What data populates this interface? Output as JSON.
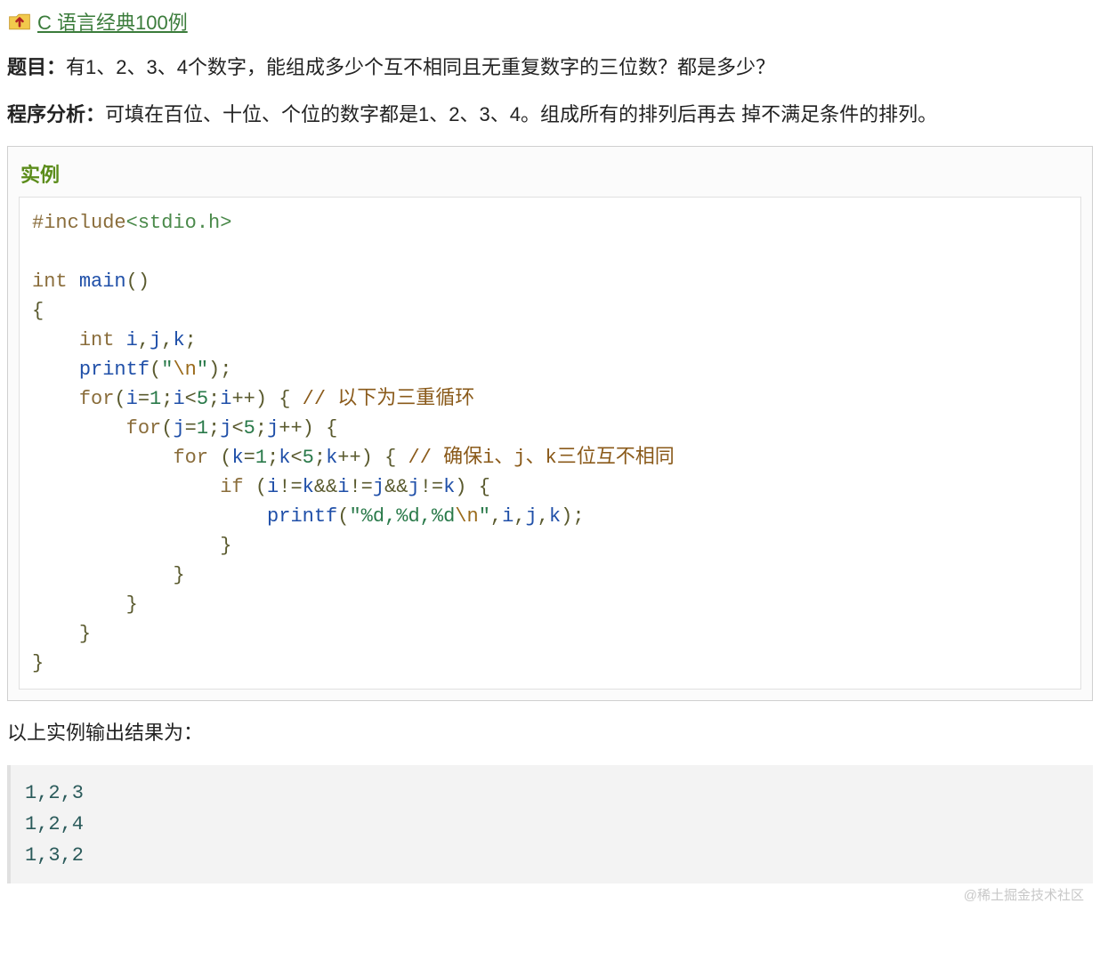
{
  "nav": {
    "link_text": "C 语言经典100例"
  },
  "problem": {
    "label": "题目：",
    "text": "有1、2、3、4个数字，能组成多少个互不相同且无重复数字的三位数？都是多少？"
  },
  "analysis": {
    "label": "程序分析：",
    "text": "可填在百位、十位、个位的数字都是1、2、3、4。组成所有的排列后再去 掉不满足条件的排列。"
  },
  "example": {
    "title": "实例"
  },
  "code": {
    "t_include": "#include",
    "t_header": "<stdio.h>",
    "t_int": "int",
    "t_main": "main",
    "t_for": "for",
    "t_if": "if",
    "t_printf": "printf",
    "v_i": "i",
    "v_j": "j",
    "v_k": "k",
    "n1": "1",
    "n5": "5",
    "s_nl_open": "\"",
    "s_nl_esc": "\\n",
    "s_nl_close": "\"",
    "s_fmt_open": "\"%d,%d,%d",
    "s_fmt_esc": "\\n",
    "s_fmt_close": "\"",
    "cmt1": "// 以下为三重循环",
    "cmt2": "// 确保i、j、k三位互不相同"
  },
  "output_label": "以上实例输出结果为：",
  "output_lines": [
    "1,2,3",
    "1,2,4",
    "1,3,2"
  ],
  "watermark": "@稀土掘金技术社区"
}
